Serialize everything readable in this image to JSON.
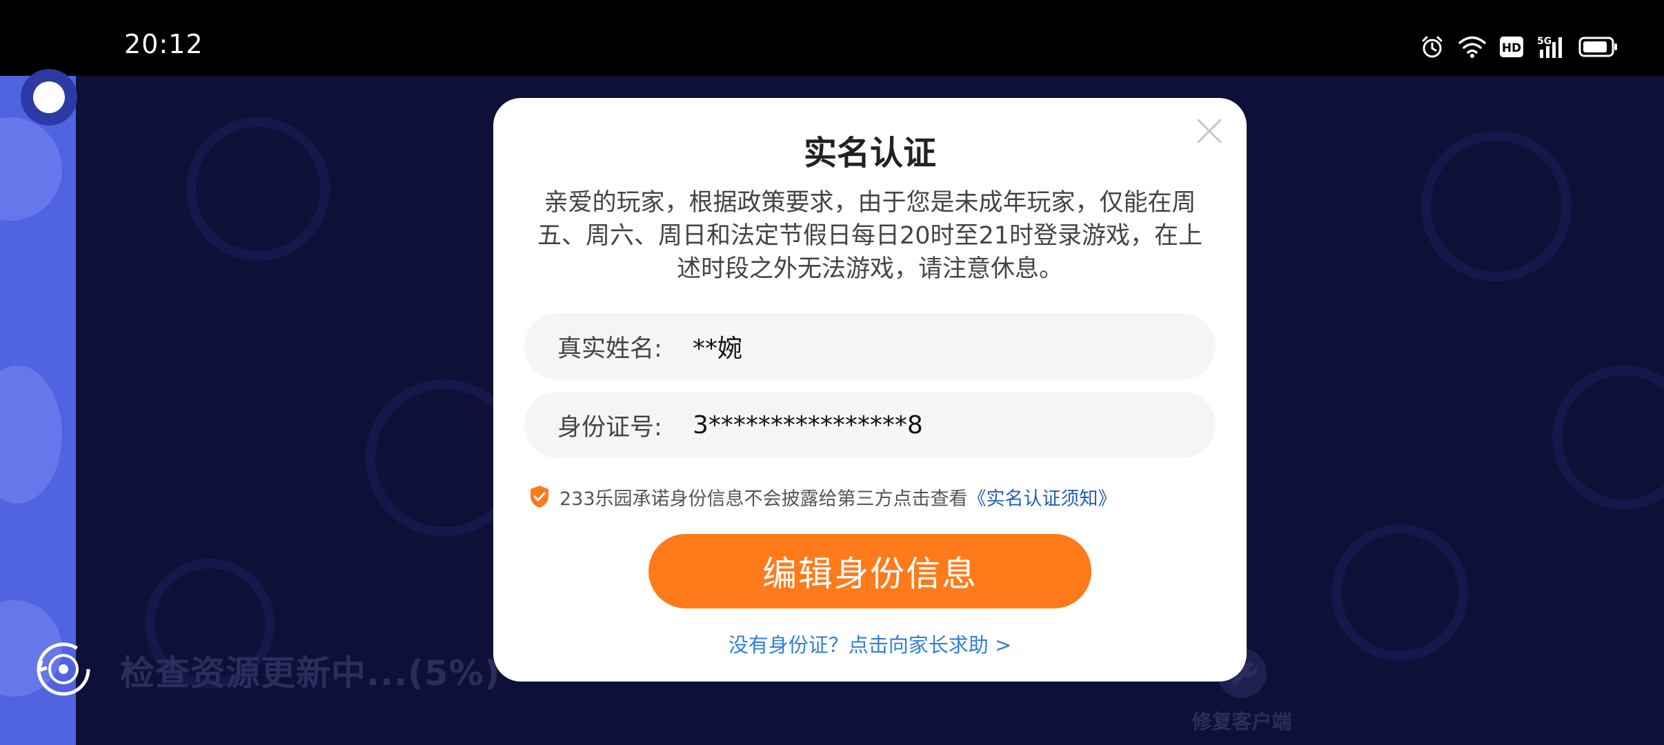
{
  "status_bar": {
    "time": "20:12",
    "icons": [
      "alarm-icon",
      "wifi-icon",
      "hd-icon",
      "5g-signal-icon",
      "battery-icon"
    ],
    "hd_label": "HD",
    "network_label": "5G"
  },
  "background": {
    "progress_text": "检查资源更新中...(5%)",
    "repair_label": "修复客户端"
  },
  "dialog": {
    "title": "实名认证",
    "description": "亲爱的玩家，根据政策要求，由于您是未成年玩家，仅能在周五、周六、周日和法定节假日每日20时至21时登录游戏，在上述时段之外无法游戏，请注意休息。",
    "name_field": {
      "label": "真实姓名:",
      "value": "**婉"
    },
    "id_field": {
      "label": "身份证号:",
      "value": "3****************8"
    },
    "notice": {
      "text": "233乐园承诺身份信息不会披露给第三方点击查看",
      "link": "《实名认证须知》"
    },
    "primary_button": "编辑身份信息",
    "parent_help_link": "没有身份证？点击向家长求助 >"
  },
  "colors": {
    "accent": "#ff7a1a",
    "link": "#1f5fb5",
    "help_link": "#2f7fd8",
    "background": "#0e1038",
    "strip": "#5063e0"
  }
}
